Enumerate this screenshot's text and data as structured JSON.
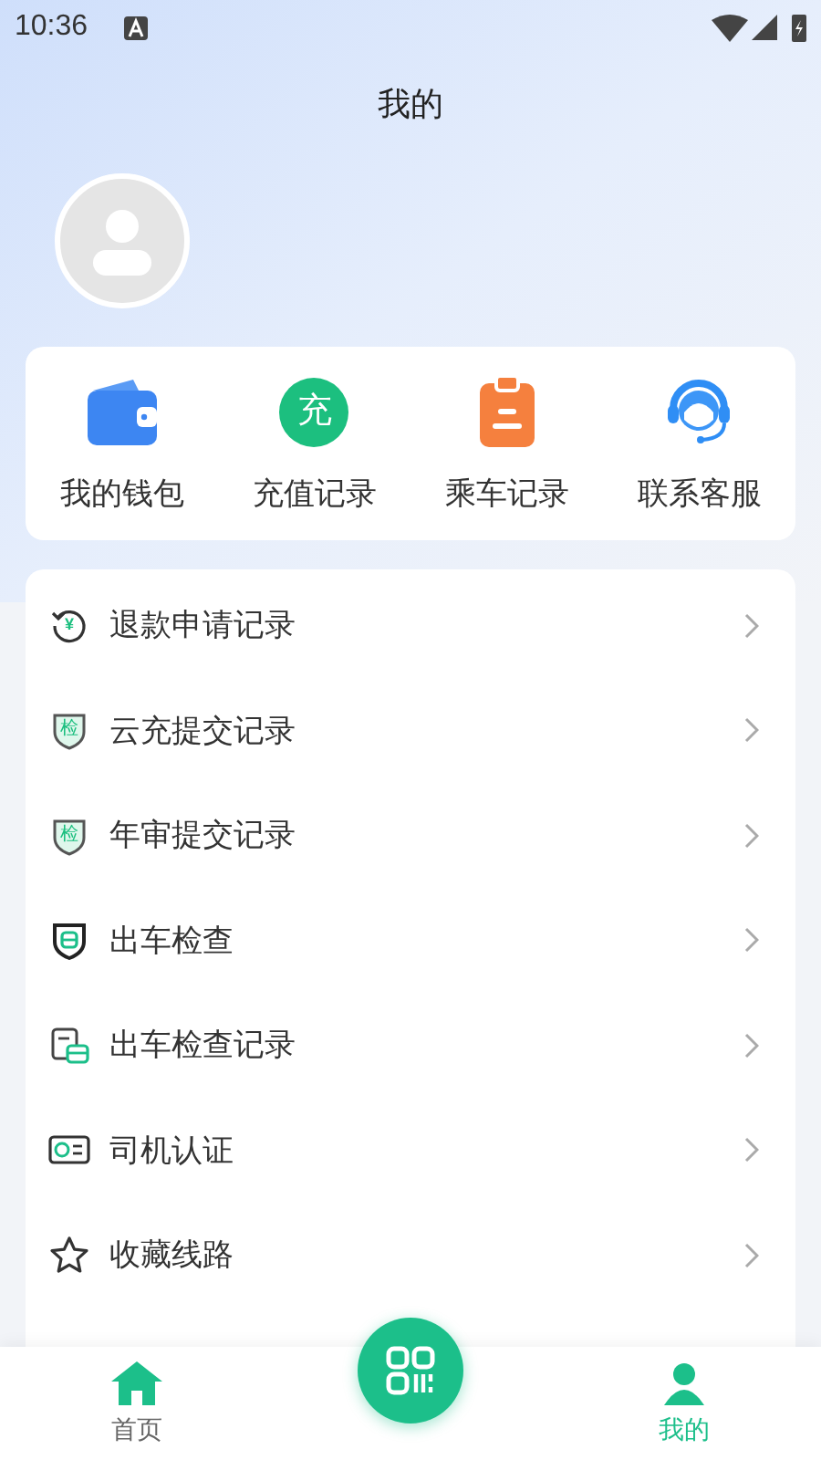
{
  "status_bar": {
    "time": "10:36"
  },
  "header": {
    "title": "我的"
  },
  "quick_actions": [
    {
      "kind": "wallet",
      "label": "我的钱包"
    },
    {
      "kind": "recharge",
      "label": "充值记录",
      "icon_text": "充"
    },
    {
      "kind": "ride",
      "label": "乘车记录"
    },
    {
      "kind": "service",
      "label": "联系客服"
    }
  ],
  "menu": [
    {
      "kind": "refund",
      "label": "退款申请记录",
      "icon_text": "¥"
    },
    {
      "kind": "check-shield",
      "label": "云充提交记录",
      "icon_text": "检"
    },
    {
      "kind": "check-shield",
      "label": "年审提交记录",
      "icon_text": "检"
    },
    {
      "kind": "bus-shield",
      "label": "出车检查"
    },
    {
      "kind": "clipboard-bus",
      "label": "出车检查记录"
    },
    {
      "kind": "id-card",
      "label": "司机认证"
    },
    {
      "kind": "star",
      "label": "收藏线路"
    }
  ],
  "bottom_nav": [
    {
      "kind": "home",
      "label": "首页",
      "selected": false
    },
    {
      "kind": "scan"
    },
    {
      "kind": "me",
      "label": "我的",
      "selected": true
    }
  ]
}
